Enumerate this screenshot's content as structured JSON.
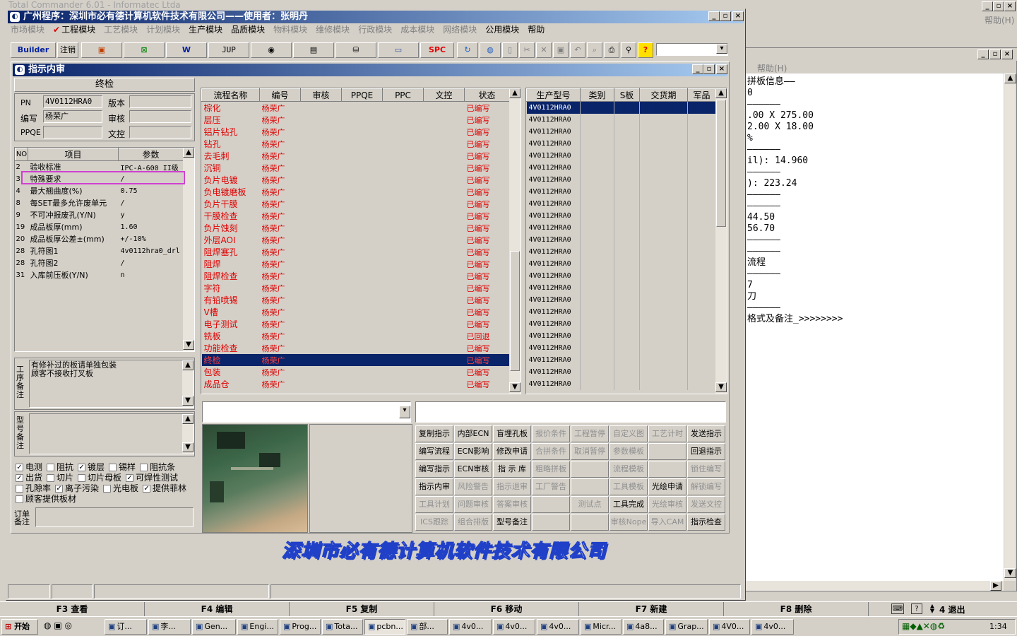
{
  "bg_window": {
    "title": "Total Commander 6.01 - Informatec Ltda",
    "help_menu": "帮助(H)",
    "help_menu2": "帮助(H)",
    "text_lines": [
      "拼板信息——",
      "0",
      "——————",
      ".00 X 275.00",
      "2.00 X 18.00",
      "%",
      "——————",
      "il): 14.960",
      "——————",
      "): 223.24",
      "——————",
      "——————",
      "44.50",
      "56.70",
      "——————",
      "——————",
      "流程",
      "——————",
      "7",
      "刀",
      "——————",
      "格式及备注_>>>>>>>>"
    ]
  },
  "main_window": {
    "title": "广州程序：深圳市必有德计算机软件技术有限公司——使用者：张明丹",
    "menu": [
      {
        "label": "市场模块",
        "enabled": false
      },
      {
        "label": "工程模块",
        "enabled": true,
        "checked": true
      },
      {
        "label": "工艺模块",
        "enabled": false
      },
      {
        "label": "计划模块",
        "enabled": false
      },
      {
        "label": "生产模块",
        "enabled": true
      },
      {
        "label": "品质模块",
        "enabled": true
      },
      {
        "label": "物料模块",
        "enabled": false
      },
      {
        "label": "维修模块",
        "enabled": false
      },
      {
        "label": "行政模块",
        "enabled": false
      },
      {
        "label": "成本模块",
        "enabled": false
      },
      {
        "label": "网络模块",
        "enabled": false
      },
      {
        "label": "公用模块",
        "enabled": true
      },
      {
        "label": "帮助",
        "enabled": true
      }
    ],
    "toolbar": {
      "builder": "Builder",
      "logout": "注销",
      "jup": "JUP",
      "spc": "SPC",
      "combo_value": ""
    },
    "company_banner": "深圳市必有德计算机软件技术有限公司"
  },
  "child_window": {
    "title": "指示内审",
    "section_title": "终检",
    "fields": {
      "pn_label": "PN",
      "pn_value": "4V0112HRA0",
      "version_label": "版本",
      "version_value": "",
      "code_label": "编写",
      "code_value": "杨荣广",
      "review_label": "审核",
      "review_value": "",
      "ppqe_label": "PPQE",
      "ppqe_value": "",
      "doc_label": "文控",
      "doc_value": ""
    },
    "param_headers": [
      "NO",
      "项目",
      "参数"
    ],
    "params": [
      {
        "no": "2",
        "item": "验收标准",
        "value": "IPC-A-600 II级"
      },
      {
        "no": "3",
        "item": "特殊要求",
        "value": "/",
        "highlight": true
      },
      {
        "no": "4",
        "item": "最大翘曲度(%)",
        "value": "0.75"
      },
      {
        "no": "8",
        "item": "每SET最多允许废单元",
        "value": "/"
      },
      {
        "no": "9",
        "item": "不可冲报废孔(Y/N)",
        "value": "y"
      },
      {
        "no": "19",
        "item": "成品板厚(mm)",
        "value": "1.60"
      },
      {
        "no": "20",
        "item": "成品板厚公差±(mm)",
        "value": "+/-10%"
      },
      {
        "no": "28",
        "item": "孔符图1",
        "value": "4v0112hra0_drl"
      },
      {
        "no": "28",
        "item": "孔符图2",
        "value": "/"
      },
      {
        "no": "31",
        "item": "入库前压板(Y/N)",
        "value": "n"
      }
    ],
    "process_note_label": "工序备注",
    "process_note_lines": [
      "有修补过的板请单独包装",
      "顾客不接收打叉板"
    ],
    "model_note_label": "型号备注",
    "order_note_label": "订单备注",
    "checkboxes": [
      {
        "label": "电测",
        "checked": true
      },
      {
        "label": "阻抗",
        "checked": false
      },
      {
        "label": "镀层",
        "checked": true
      },
      {
        "label": "锡样",
        "checked": false
      },
      {
        "label": "阻抗条",
        "checked": false
      },
      {
        "label": "出货",
        "checked": true
      },
      {
        "label": "切片",
        "checked": false
      },
      {
        "label": "切片母板",
        "checked": false
      },
      {
        "label": "可焊性测试",
        "checked": true
      },
      {
        "label": "孔隙率",
        "checked": false
      },
      {
        "label": "离子污染",
        "checked": true
      },
      {
        "label": "光电板",
        "checked": false
      },
      {
        "label": "提供菲林",
        "checked": true
      },
      {
        "label": "顾客提供板材",
        "checked": false
      }
    ],
    "flow_headers": [
      "流程名称",
      "编号",
      "审核",
      "PPQE",
      "PPC",
      "文控",
      "状态"
    ],
    "flow_rows": [
      {
        "name": "棕化",
        "code": "杨荣广",
        "status": "已编写"
      },
      {
        "name": "层压",
        "code": "杨荣广",
        "status": "已编写"
      },
      {
        "name": "铝片钻孔",
        "code": "杨荣广",
        "status": "已编写"
      },
      {
        "name": "钻孔",
        "code": "杨荣广",
        "status": "已编写"
      },
      {
        "name": "去毛刺",
        "code": "杨荣广",
        "status": "已编写"
      },
      {
        "name": "沉铜",
        "code": "杨荣广",
        "status": "已编写"
      },
      {
        "name": "负片电镀",
        "code": "杨荣广",
        "status": "已编写"
      },
      {
        "name": "负电镀磨板",
        "code": "杨荣广",
        "status": "已编写"
      },
      {
        "name": "负片干膜",
        "code": "杨荣广",
        "status": "已编写"
      },
      {
        "name": "干膜检查",
        "code": "杨荣广",
        "status": "已编写"
      },
      {
        "name": "负片蚀刻",
        "code": "杨荣广",
        "status": "已编写"
      },
      {
        "name": "外层AOI",
        "code": "杨荣广",
        "status": "已编写"
      },
      {
        "name": "阻焊塞孔",
        "code": "杨荣广",
        "status": "已编写"
      },
      {
        "name": "阻焊",
        "code": "杨荣广",
        "status": "已编写"
      },
      {
        "name": "阻焊检查",
        "code": "杨荣广",
        "status": "已编写"
      },
      {
        "name": "字符",
        "code": "杨荣广",
        "status": "已编写"
      },
      {
        "name": "有铅喷锡",
        "code": "杨荣广",
        "status": "已编写"
      },
      {
        "name": "V槽",
        "code": "杨荣广",
        "status": "已编写"
      },
      {
        "name": "电子测试",
        "code": "杨荣广",
        "status": "已编写"
      },
      {
        "name": "铣板",
        "code": "杨荣广",
        "status": "已回退"
      },
      {
        "name": "功能检查",
        "code": "杨荣广",
        "status": "已编写"
      },
      {
        "name": "终检",
        "code": "杨荣广",
        "status": "已编写",
        "selected": true
      },
      {
        "name": "包装",
        "code": "杨荣广",
        "status": "已编写"
      },
      {
        "name": "成品仓",
        "code": "杨荣广",
        "status": "已编写"
      }
    ],
    "model_headers": [
      "生产型号",
      "类别",
      "S板",
      "交货期",
      "军品"
    ],
    "model_rows": [
      "4V0112HRA0",
      "4V0112HRA0",
      "4V0112HRA0",
      "4V0112HRA0",
      "4V0112HRA0",
      "4V0112HRA0",
      "4V0112HRA0",
      "4V0112HRA0",
      "4V0112HRA0",
      "4V0112HRA0",
      "4V0112HRA0",
      "4V0112HRA0",
      "4V0112HRA0",
      "4V0112HRA0",
      "4V0112HRA0",
      "4V0112HRA0",
      "4V0112HRA0",
      "4V0112HRA0",
      "4V0112HRA0",
      "4V0112HRA0",
      "4V0112HRA0",
      "4V0112HRA0",
      "4V0112HRA0",
      "4V0112HRA0"
    ],
    "action_buttons": [
      [
        {
          "label": "复制指示",
          "enabled": true
        },
        {
          "label": "内部ECN",
          "enabled": true
        },
        {
          "label": "盲埋孔板",
          "enabled": true
        },
        {
          "label": "报价条件",
          "enabled": false
        },
        {
          "label": "工程暂停",
          "enabled": false
        },
        {
          "label": "自定义图",
          "enabled": false
        },
        {
          "label": "工艺计时",
          "enabled": false
        },
        {
          "label": "发送指示",
          "enabled": true
        }
      ],
      [
        {
          "label": "编写流程",
          "enabled": true
        },
        {
          "label": "ECN影响",
          "enabled": true
        },
        {
          "label": "修改申请",
          "enabled": true
        },
        {
          "label": "合拼条件",
          "enabled": false
        },
        {
          "label": "取消暂停",
          "enabled": false
        },
        {
          "label": "参数模板",
          "enabled": false
        },
        {
          "label": "",
          "enabled": false
        },
        {
          "label": "回退指示",
          "enabled": true
        }
      ],
      [
        {
          "label": "编写指示",
          "enabled": true
        },
        {
          "label": "ECN审核",
          "enabled": true
        },
        {
          "label": "指 示 库",
          "enabled": true
        },
        {
          "label": "粗略拼板",
          "enabled": false
        },
        {
          "label": "",
          "enabled": false
        },
        {
          "label": "流程模板",
          "enabled": false
        },
        {
          "label": "",
          "enabled": false
        },
        {
          "label": "锁住编写",
          "enabled": false
        }
      ],
      [
        {
          "label": "指示内审",
          "enabled": true
        },
        {
          "label": "风险警告",
          "enabled": false
        },
        {
          "label": "指示退审",
          "enabled": false
        },
        {
          "label": "工厂警告",
          "enabled": false
        },
        {
          "label": "",
          "enabled": false
        },
        {
          "label": "工具模板",
          "enabled": false
        },
        {
          "label": "光绘申请",
          "enabled": true
        },
        {
          "label": "解锁编写",
          "enabled": false
        }
      ],
      [
        {
          "label": "工具计划",
          "enabled": false
        },
        {
          "label": "问题审核",
          "enabled": false
        },
        {
          "label": "答案审核",
          "enabled": false
        },
        {
          "label": "",
          "enabled": false
        },
        {
          "label": "测试点",
          "enabled": false
        },
        {
          "label": "工具完成",
          "enabled": true
        },
        {
          "label": "光绘审核",
          "enabled": false
        },
        {
          "label": "发送文控",
          "enabled": false
        }
      ],
      [
        {
          "label": "ICS跟踪",
          "enabled": false
        },
        {
          "label": "组合排版",
          "enabled": false
        },
        {
          "label": "型号备注",
          "enabled": true
        },
        {
          "label": "",
          "enabled": false
        },
        {
          "label": "",
          "enabled": false
        },
        {
          "label": "审核Nope",
          "enabled": false
        },
        {
          "label": "导入CAM",
          "enabled": false
        },
        {
          "label": "指示检查",
          "enabled": true
        }
      ]
    ]
  },
  "fkeys": [
    "F3 查看",
    "F4 编辑",
    "F5 复制",
    "F6 移动",
    "F7 新建",
    "F8 删除",
    "4 退出"
  ],
  "taskbar": {
    "start": "开始",
    "tasks": [
      "订...",
      "李...",
      "Gen...",
      "Engi...",
      "Prog...",
      "Tota...",
      "pcbn...",
      "部...",
      "4v0...",
      "4v0...",
      "4v0...",
      "Micr...",
      "4a8...",
      "Grap...",
      "4V0...",
      "4v0..."
    ],
    "clock": "1:34"
  },
  "colors": {
    "accent": "#0a246a",
    "status_red": "#e00000",
    "highlight_box": "#d040d0",
    "banner_blue": "#2040c8"
  }
}
